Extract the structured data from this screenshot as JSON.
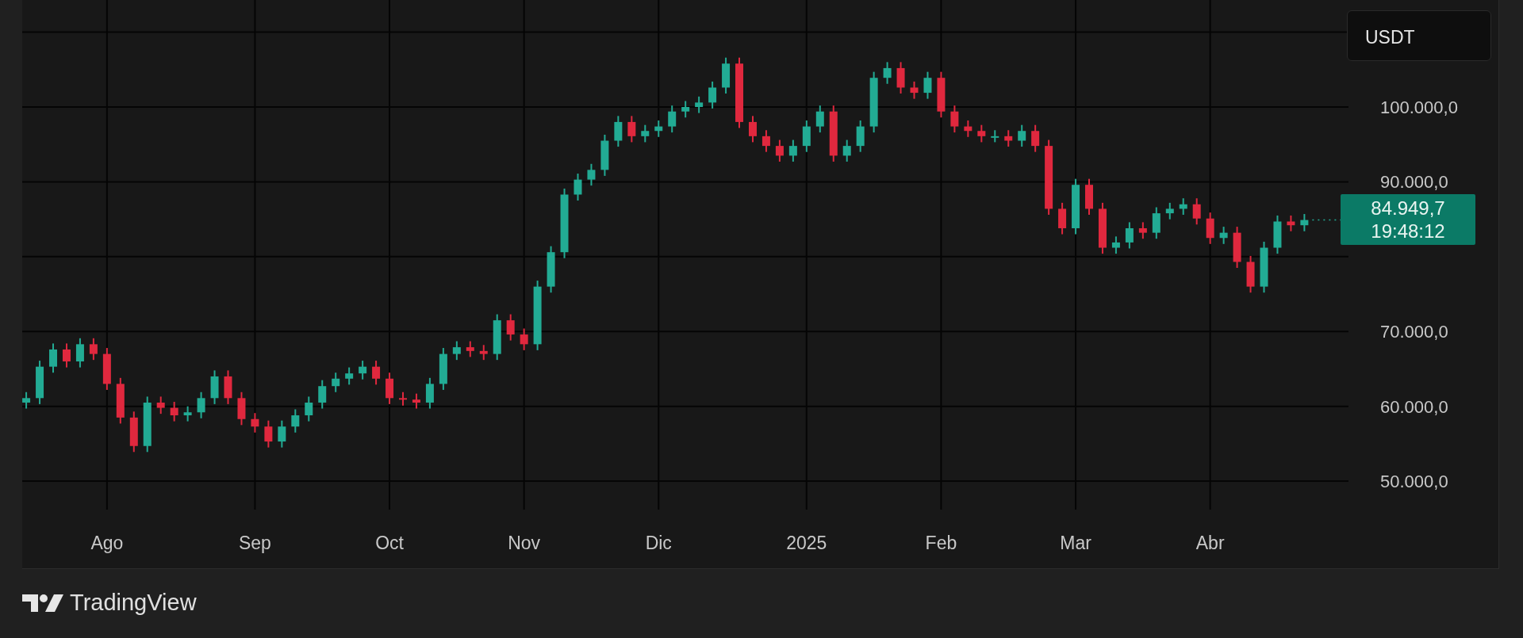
{
  "chart": {
    "currency": "USDT",
    "chart_data": {
      "type": "candlestick",
      "ylim": [
        46200,
        114300
      ],
      "grid": true,
      "categories": [
        null,
        null,
        null,
        null,
        null,
        null,
        "Ago",
        null,
        null,
        null,
        null,
        null,
        null,
        null,
        null,
        null,
        null,
        "Sep",
        null,
        null,
        null,
        null,
        null,
        null,
        null,
        null,
        null,
        "Oct",
        null,
        null,
        null,
        null,
        null,
        null,
        null,
        null,
        null,
        "Nov",
        null,
        null,
        null,
        null,
        null,
        null,
        null,
        null,
        null,
        "Dic",
        null,
        null,
        null,
        null,
        null,
        null,
        null,
        null,
        null,
        null,
        "2025",
        null,
        null,
        null,
        null,
        null,
        null,
        null,
        null,
        null,
        "Feb",
        null,
        null,
        null,
        null,
        null,
        null,
        null,
        null,
        null,
        "Mar",
        null,
        null,
        null,
        null,
        null,
        null,
        null,
        null,
        null,
        "Abr",
        null,
        null,
        null,
        null,
        null,
        null,
        null
      ],
      "ohlc": [
        [
          60500,
          61900,
          59700,
          61100
        ],
        [
          61100,
          66100,
          60300,
          65300
        ],
        [
          65300,
          68400,
          64500,
          67600
        ],
        [
          67600,
          68400,
          65200,
          66000
        ],
        [
          66000,
          69100,
          65200,
          68300
        ],
        [
          68300,
          69100,
          66200,
          67000
        ],
        [
          67000,
          67800,
          62200,
          63000
        ],
        [
          63000,
          63800,
          57700,
          58500
        ],
        [
          58500,
          59300,
          53900,
          54700
        ],
        [
          54700,
          61300,
          53900,
          60500
        ],
        [
          60500,
          61300,
          59000,
          59800
        ],
        [
          59800,
          60600,
          58000,
          58800
        ],
        [
          58800,
          60000,
          58000,
          59200
        ],
        [
          59200,
          61900,
          58400,
          61100
        ],
        [
          61100,
          64800,
          60300,
          64000
        ],
        [
          64000,
          64800,
          60300,
          61100
        ],
        [
          61100,
          61900,
          57500,
          58300
        ],
        [
          58300,
          59100,
          56500,
          57300
        ],
        [
          57300,
          58100,
          54500,
          55300
        ],
        [
          55300,
          58100,
          54500,
          57300
        ],
        [
          57300,
          59600,
          56500,
          58800
        ],
        [
          58800,
          61300,
          58000,
          60500
        ],
        [
          60500,
          63500,
          59700,
          62700
        ],
        [
          62700,
          64500,
          61900,
          63700
        ],
        [
          63700,
          65200,
          62900,
          64400
        ],
        [
          64400,
          66100,
          63600,
          65300
        ],
        [
          65300,
          66100,
          62900,
          63700
        ],
        [
          63700,
          64500,
          60300,
          61100
        ],
        [
          61100,
          61900,
          60100,
          60900
        ],
        [
          60900,
          61700,
          59700,
          60500
        ],
        [
          60500,
          63800,
          59700,
          63000
        ],
        [
          63000,
          67800,
          62200,
          67000
        ],
        [
          67000,
          68700,
          66200,
          67900
        ],
        [
          67900,
          68700,
          66600,
          67400
        ],
        [
          67400,
          68200,
          66200,
          67000
        ],
        [
          67000,
          72300,
          66200,
          71500
        ],
        [
          71500,
          72300,
          68800,
          69600
        ],
        [
          69600,
          70400,
          67500,
          68300
        ],
        [
          68300,
          76800,
          67500,
          76000
        ],
        [
          76000,
          81400,
          75200,
          80600
        ],
        [
          80600,
          89100,
          79800,
          88300
        ],
        [
          88300,
          91100,
          87500,
          90300
        ],
        [
          90300,
          92400,
          89500,
          91600
        ],
        [
          91600,
          96300,
          90800,
          95500
        ],
        [
          95500,
          98800,
          94700,
          98000
        ],
        [
          98000,
          98800,
          95300,
          96100
        ],
        [
          96100,
          97600,
          95300,
          96800
        ],
        [
          96800,
          98200,
          96000,
          97400
        ],
        [
          97400,
          100200,
          96600,
          99400
        ],
        [
          99400,
          100800,
          98600,
          100000
        ],
        [
          100000,
          101400,
          99200,
          100600
        ],
        [
          100600,
          103400,
          99800,
          102600
        ],
        [
          102600,
          106600,
          101800,
          105800
        ],
        [
          105800,
          106600,
          97200,
          98000
        ],
        [
          98000,
          98800,
          95300,
          96100
        ],
        [
          96100,
          96900,
          94000,
          94800
        ],
        [
          94800,
          95600,
          92700,
          93500
        ],
        [
          93500,
          95600,
          92700,
          94800
        ],
        [
          94800,
          98200,
          94000,
          97400
        ],
        [
          97400,
          100200,
          96600,
          99400
        ],
        [
          99400,
          100200,
          92700,
          93500
        ],
        [
          93500,
          95600,
          92700,
          94800
        ],
        [
          94800,
          98200,
          94000,
          97400
        ],
        [
          97400,
          104700,
          96600,
          103900
        ],
        [
          103900,
          106000,
          103100,
          105200
        ],
        [
          105200,
          106000,
          101800,
          102600
        ],
        [
          102600,
          103400,
          101100,
          101900
        ],
        [
          101900,
          104700,
          101100,
          103900
        ],
        [
          103900,
          104700,
          98600,
          99400
        ],
        [
          99400,
          100200,
          96600,
          97400
        ],
        [
          97400,
          98200,
          96000,
          96800
        ],
        [
          96800,
          97600,
          95300,
          96100
        ],
        [
          96100,
          96900,
          95300,
          96100
        ],
        [
          96100,
          96900,
          94700,
          95500
        ],
        [
          95500,
          97600,
          94700,
          96800
        ],
        [
          96800,
          97600,
          94000,
          94800
        ],
        [
          94800,
          95600,
          85600,
          86400
        ],
        [
          86400,
          87200,
          83000,
          83800
        ],
        [
          83800,
          90400,
          83000,
          89600
        ],
        [
          89600,
          90400,
          85600,
          86400
        ],
        [
          86400,
          87200,
          80400,
          81200
        ],
        [
          81200,
          82700,
          80400,
          81900
        ],
        [
          81900,
          84600,
          81100,
          83800
        ],
        [
          83800,
          84600,
          82400,
          83200
        ],
        [
          83200,
          86600,
          82400,
          85800
        ],
        [
          85800,
          87200,
          85000,
          86400
        ],
        [
          86400,
          87800,
          85600,
          87000
        ],
        [
          87000,
          87800,
          84300,
          85100
        ],
        [
          85100,
          85900,
          81700,
          82500
        ],
        [
          82500,
          84000,
          81700,
          83200
        ],
        [
          83200,
          84000,
          78500,
          79300
        ],
        [
          79300,
          80100,
          75200,
          76000
        ],
        [
          76000,
          82000,
          75200,
          81200
        ],
        [
          81200,
          85500,
          80400,
          84700
        ],
        [
          84700,
          85500,
          83400,
          84200
        ],
        [
          84200,
          85700,
          83400,
          84900
        ]
      ],
      "yticks": [
        {
          "value": 50000,
          "label": "50.000,0"
        },
        {
          "value": 60000,
          "label": "60.000,0"
        },
        {
          "value": 70000,
          "label": "70.000,0"
        },
        {
          "value": 90000,
          "label": "90.000,0"
        },
        {
          "value": 100000,
          "label": "100.000,0"
        }
      ]
    },
    "last_price": {
      "price": "84.949,7",
      "countdown": "19:48:12"
    }
  },
  "footer": {
    "brand": "TradingView"
  }
}
